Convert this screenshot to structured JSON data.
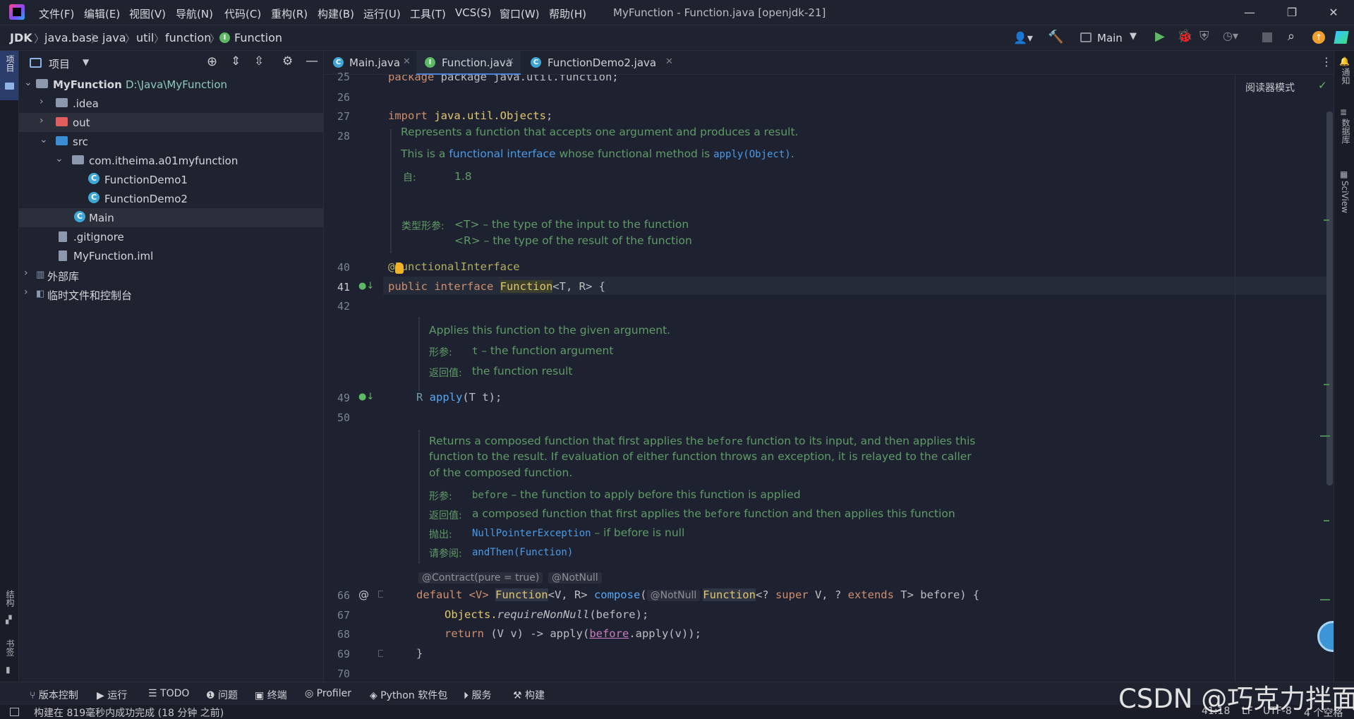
{
  "titlebar": {
    "menus": [
      "文件(F)",
      "编辑(E)",
      "视图(V)",
      "导航(N)",
      "代码(C)",
      "重构(R)",
      "构建(B)",
      "运行(U)",
      "工具(T)",
      "VCS(S)",
      "窗口(W)",
      "帮助(H)"
    ],
    "title": "MyFunction - Function.java [openjdk-21]",
    "minimize": "—",
    "restore": "❐",
    "close": "✕"
  },
  "breadcrumb": {
    "items": [
      "JDK",
      "java.base",
      "java",
      "util",
      "function",
      "Function"
    ],
    "sep": "〉"
  },
  "navtools": {
    "run_config": "Main"
  },
  "left_strip": {
    "project_label": "项目",
    "structure_label": "结构",
    "bookmarks_label": "书签"
  },
  "project_panel": {
    "title": "项目",
    "tree": [
      {
        "label": "MyFunction",
        "path": "D:\\Java\\MyFunction"
      },
      {
        "label": ".idea"
      },
      {
        "label": "out"
      },
      {
        "label": "src"
      },
      {
        "label": "com.itheima.a01myfunction"
      },
      {
        "label": "FunctionDemo1"
      },
      {
        "label": "FunctionDemo2"
      },
      {
        "label": "Main"
      },
      {
        "label": ".gitignore"
      },
      {
        "label": "MyFunction.iml"
      },
      {
        "label": "外部库"
      },
      {
        "label": "临时文件和控制台"
      }
    ]
  },
  "tabs": [
    {
      "label": "Main.java"
    },
    {
      "label": "Function.java"
    },
    {
      "label": "FunctionDemo2.java"
    }
  ],
  "editor": {
    "reader_mode": "阅读器模式",
    "line_numbers": [
      "25",
      "26",
      "27",
      "28",
      "40",
      "41",
      "42",
      "49",
      "50",
      "66",
      "67",
      "68",
      "69",
      "70"
    ],
    "lines": {
      "l25": "package java.util.function;",
      "l27a": "import ",
      "l27b": "java.util.Objects",
      "l27c": ";",
      "l40": "@FunctionalInterface",
      "l41a": "public interface ",
      "l41b": "Function",
      "l41c": "<T, R> {",
      "l49a": "R ",
      "l49b": "apply",
      "l49c": "(T t);",
      "l66a": "default <V> ",
      "l66b": "Function",
      "l66c": "<V, R> ",
      "l66d": "compose",
      "l66e": "(",
      "l66f": "Function",
      "l66g": "<? ",
      "l66h": "super",
      "l66i": " V, ? ",
      "l66j": "extends",
      "l66k": " T> before) {",
      "l67a": "Objects.",
      "l67b": "requireNonNull",
      "l67c": "(before);",
      "l68a": "return ",
      "l68b": "(V v) -> apply(",
      "l68c": "before",
      "l68d": ".apply(v));",
      "l69": "}"
    },
    "doc1": {
      "line1": "Represents a function that accepts one argument and produces a result.",
      "line2a": "This is a ",
      "line2b": "functional interface",
      "line2c": " whose functional method is ",
      "line2d": "apply(Object)",
      "line2e": ".",
      "since_label": "自:",
      "since_value": "1.8",
      "params_label": "类型形参:",
      "param1": "<T> – the type of the input to the function",
      "param2": "<R> – the type of the result of the function"
    },
    "doc2": {
      "line1": "Applies this function to the given argument.",
      "params_label": "形参:",
      "param_name": "t",
      "param_desc": " – the function argument",
      "returns_label": "返回值:",
      "returns_value": "the function result"
    },
    "doc3": {
      "line1a": "Returns a composed function that first applies the ",
      "line1b": "before",
      "line1c": " function to its input, and then applies this",
      "line2": "function to the result. If evaluation of either function throws an exception, it is relayed to the caller",
      "line3": "of the composed function.",
      "params_label": "形参:",
      "param_name": "before",
      "param_desc": " – the function to apply before this function is applied",
      "returns_label": "返回值:",
      "returns_a": "a composed function that first applies the ",
      "returns_b": "before",
      "returns_c": " function and then applies this function",
      "throws_label": "抛出:",
      "throws_name": "NullPointerException",
      "throws_desc": " – if before is null",
      "see_label": "请参阅:",
      "see_value": "andThen(Function)"
    },
    "hints": {
      "contract": "@Contract(pure = true)",
      "notnull1": "@NotNull",
      "notnull2": "@NotNull"
    }
  },
  "right_strip": {
    "notifications": "通知",
    "database": "数据库",
    "sciview": "SciView"
  },
  "bottom_tools": [
    "版本控制",
    "运行",
    "TODO",
    "问题",
    "终端",
    "Profiler",
    "Python 软件包",
    "服务",
    "构建"
  ],
  "status": {
    "message": "构建在 819毫秒内成功完成 (18 分钟 之前)",
    "position": "41:18",
    "line_sep": "LF",
    "encoding": "UTF-8",
    "indent": "4 个空格"
  },
  "watermark": "CSDN @巧克力拌面"
}
